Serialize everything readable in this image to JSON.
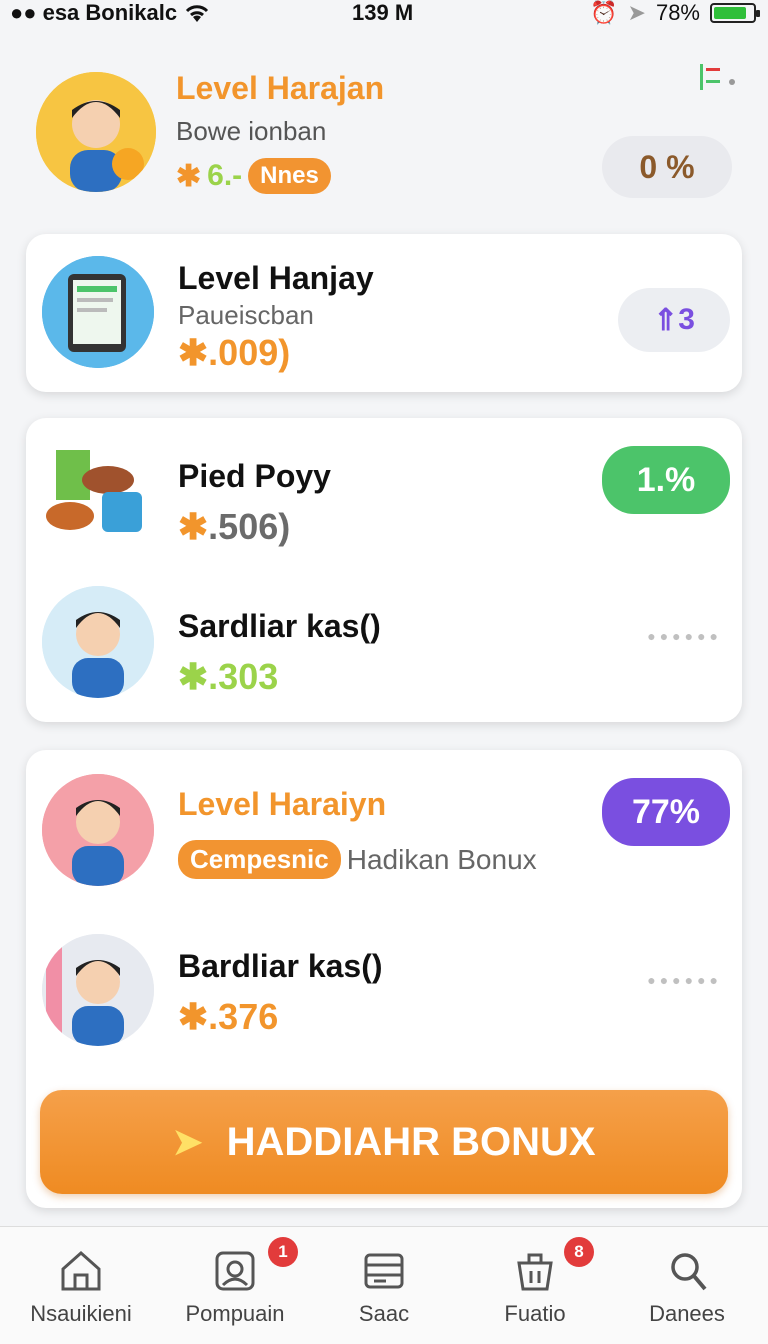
{
  "status_bar": {
    "carrier": "esa Bonikalc",
    "time": "139 M",
    "battery": "78%",
    "battery_level": 0.78
  },
  "header": {
    "title": "Level Harajan",
    "subtitle": "Bowe ionban",
    "stat": "6.-",
    "stat_tag": "Nnes",
    "percent": "0 %"
  },
  "card1": {
    "title": "Level Hanjay",
    "subtitle": "Paueiscban",
    "stat": ".009)",
    "badge": "3",
    "badge_icon": "double-arrow-up-icon"
  },
  "card2": {
    "rows": [
      {
        "title": "Pied Poyy",
        "stat": ".506)",
        "badge": "1.%"
      },
      {
        "title": "Sardliar kas()",
        "stat": ".303"
      }
    ]
  },
  "card3": {
    "title": "Level Haraiyn",
    "tag": "Cempesnic",
    "tag_text": "Hadikan Bonux",
    "badge": "77%",
    "row2": {
      "title": "Bardliar kas()",
      "stat": ".376"
    },
    "cta": "HADDIAHR BONUX"
  },
  "bottom_nav": {
    "items": [
      {
        "label": "Nsauikieni",
        "icon": "home-icon"
      },
      {
        "label": "Pompuain",
        "icon": "profile-card-icon",
        "badge": "1"
      },
      {
        "label": "Saac",
        "icon": "wallet-icon"
      },
      {
        "label": "Fuatio",
        "icon": "bag-icon",
        "badge": "8"
      },
      {
        "label": "Danees",
        "icon": "search-icon"
      }
    ]
  },
  "colors": {
    "accent": "#f2952c",
    "green": "#4cc46a",
    "purple": "#7a4fe0",
    "red": "#e23b3b"
  }
}
